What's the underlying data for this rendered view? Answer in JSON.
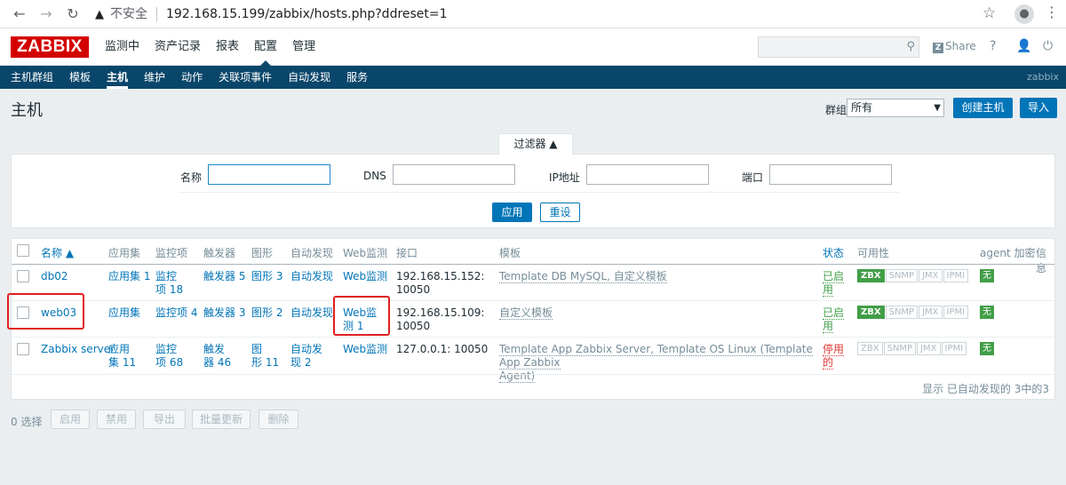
{
  "browser": {
    "insecure_label": "不安全",
    "url": "192.168.15.199/zabbix/hosts.php?ddreset=1"
  },
  "header": {
    "logo": "ZABBIX",
    "menu": [
      "监测中",
      "资产记录",
      "报表",
      "配置",
      "管理"
    ],
    "active_menu": "配置",
    "share": "Share",
    "help": "?"
  },
  "submenu": {
    "items": [
      "主机群组",
      "模板",
      "主机",
      "维护",
      "动作",
      "关联项事件",
      "自动发现",
      "服务"
    ],
    "brand": "zabbix"
  },
  "page": {
    "title": "主机",
    "group_label": "群组",
    "group_value": "所有",
    "create_host": "创建主机",
    "import": "导入"
  },
  "filter": {
    "tab_label": "过滤器 ▲",
    "name_label": "名称",
    "dns_label": "DNS",
    "ip_label": "IP地址",
    "port_label": "端口",
    "apply": "应用",
    "reset": "重设"
  },
  "table": {
    "headers": {
      "name": "名称 ▲",
      "apps": "应用集",
      "items": "监控项",
      "triggers": "触发器",
      "graphs": "图形",
      "discovery": "自动发现",
      "web": "Web监测",
      "interface": "接口",
      "templates": "模板",
      "status": "状态",
      "availability": "可用性",
      "agent_encryption": "agent 加密",
      "info": "信息"
    },
    "rows": [
      {
        "name": "db02",
        "apps": "应用集 1",
        "items_l1": "监控",
        "items_l2": "项 18",
        "triggers": "触发器 5",
        "graphs": "图形 3",
        "discovery": "自动发现",
        "web": "Web监测",
        "iface_l1": "192.168.15.152:",
        "iface_l2": "10050",
        "templates": "Template DB MySQL, 自定义模板",
        "status_l1": "已启",
        "status_l2": "用",
        "encryption": "无"
      },
      {
        "name": "web03",
        "apps": "应用集",
        "items": "监控项 4",
        "triggers": "触发器 3",
        "graphs": "图形 2",
        "discovery": "自动发现",
        "web_l1": "Web监",
        "web_l2": "测 1",
        "iface_l1": "192.168.15.109:",
        "iface_l2": "10050",
        "templates": "自定义模板",
        "status_l1": "已启",
        "status_l2": "用",
        "encryption": "无"
      },
      {
        "name": "Zabbix server",
        "apps_l1": "应用",
        "apps_l2": "集 11",
        "items_l1": "监控",
        "items_l2": "项 68",
        "triggers_l1": "触发",
        "triggers_l2": "器 46",
        "graphs_l1": "图",
        "graphs_l2": "形 11",
        "discovery_l1": "自动发",
        "discovery_l2": "现 2",
        "web": "Web监测",
        "iface": "127.0.0.1: 10050",
        "templates_l1": "Template App Zabbix Server, Template OS Linux (Template App Zabbix",
        "templates_l2": "Agent)",
        "status_l1": "停用",
        "status_l2": "的",
        "encryption": "无"
      }
    ],
    "availability_badges": [
      "ZBX",
      "SNMP",
      "JMX",
      "IPMI"
    ],
    "footer": "显示 已自动发现的 3中的3"
  },
  "actions": {
    "selected": "0 选择",
    "enable": "启用",
    "disable": "禁用",
    "export": "导出",
    "mass_update": "批量更新",
    "delete": "删除"
  },
  "colors": {
    "brand_red": "#d40000",
    "nav_blue": "#0a466a",
    "link_blue": "#0275b8",
    "green": "#429e47",
    "red": "#e33734"
  }
}
